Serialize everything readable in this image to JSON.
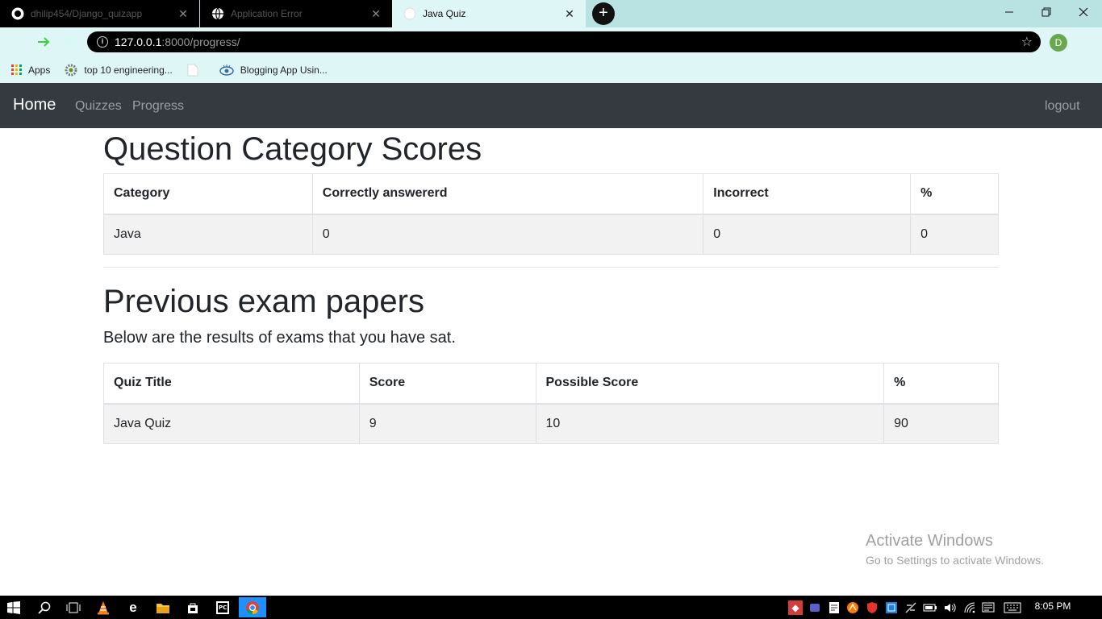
{
  "browser": {
    "tabs": [
      {
        "title": "dhilip454/Django_quizapp",
        "icon": "github-icon"
      },
      {
        "title": "Application Error",
        "icon": "globe-icon"
      },
      {
        "title": "Java Quiz",
        "icon": "globe-icon"
      }
    ],
    "new_tab_label": "+",
    "url_host": "127.0.0.1",
    "url_rest": ":8000/progress/",
    "profile_initial": "D",
    "bookmarks": [
      {
        "label": "Apps",
        "icon": "apps-grid-icon"
      },
      {
        "label": "top 10 engineering...",
        "icon": "gear-logo-icon"
      },
      {
        "label": "",
        "icon": "blank-page-icon"
      },
      {
        "label": "Blogging App Usin...",
        "icon": "eye-logo-icon"
      }
    ]
  },
  "navbar": {
    "brand": "Home",
    "links": [
      "Quizzes",
      "Progress"
    ],
    "logout": "logout",
    "bg_color": "#343a40"
  },
  "category_section": {
    "title": "Question Category Scores",
    "headers": [
      "Category",
      "Correctly answererd",
      "Incorrect",
      "%"
    ],
    "rows": [
      [
        "Java",
        "0",
        "0",
        "0"
      ]
    ]
  },
  "exam_section": {
    "title": "Previous exam papers",
    "lead": "Below are the results of exams that you have sat.",
    "headers": [
      "Quiz Title",
      "Score",
      "Possible Score",
      "%"
    ],
    "rows": [
      [
        "Java Quiz",
        "9",
        "10",
        "90"
      ]
    ]
  },
  "watermark": {
    "line1": "Activate Windows",
    "line2": "Go to Settings to activate Windows."
  },
  "taskbar": {
    "time": "8:05 PM"
  }
}
